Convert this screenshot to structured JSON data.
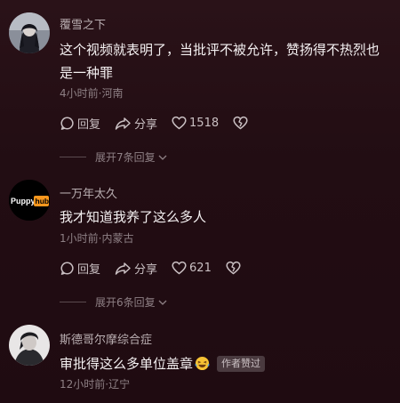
{
  "comments": [
    {
      "username": "覆雪之下",
      "text": "这个视频就表明了，当批评不被允许，赞扬得不热烈也是一种罪",
      "meta": "4小时前·河南",
      "reply_label": "回复",
      "share_label": "分享",
      "like_count": "1518",
      "expand_label": "展开7条回复"
    },
    {
      "username": "一万年太久",
      "avatar_text_1": "Puppy",
      "avatar_text_2": "hub",
      "text": "我才知道我养了这么多人",
      "meta": "1小时前·内蒙古",
      "reply_label": "回复",
      "share_label": "分享",
      "like_count": "621",
      "expand_label": "展开6条回复"
    },
    {
      "username": "斯德哥尔摩综合症",
      "text": "审批得这么多单位盖章",
      "emoji": "laughing-crying-emoji",
      "badge": "作者赞过",
      "meta": "12小时前·辽宁"
    }
  ],
  "colors": {
    "background": "#220d13",
    "username": "#b9aeb1",
    "text": "#f4f0f1",
    "meta": "#8e8085",
    "hub_orange": "#f7971e"
  },
  "icons": [
    "comment-icon",
    "share-icon",
    "heart-icon",
    "broken-heart-icon",
    "chevron-down-icon"
  ]
}
